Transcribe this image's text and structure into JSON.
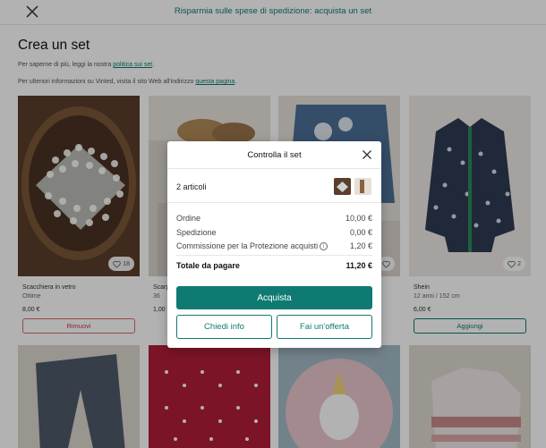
{
  "topbar": {
    "title": "Risparmia sulle spese di spedizione: acquista un set"
  },
  "page": {
    "heading": "Crea un set",
    "info1_text": "Per saperne di più, leggi la nostra ",
    "info1_link": "politica sui set",
    "info1_end": ".",
    "info2_text": "Per ulteriori informazioni su Vinted, visita il sito Web all'indirizzo ",
    "info2_link": "questa pagina",
    "info2_end": "."
  },
  "cards": [
    {
      "title": "Scacchiera in vetro",
      "subtitle": "Ottime",
      "price": "8,00 €",
      "favorites": "18",
      "button": "Rimuovi"
    },
    {
      "title": "Scarp",
      "subtitle": "36",
      "price": "1,00",
      "favorites": "",
      "button": ""
    },
    {
      "title": "",
      "subtitle": "",
      "price": "",
      "favorites": "",
      "button": ""
    },
    {
      "title": "Shein",
      "subtitle": "12 anni / 152 cm",
      "price": "6,00 €",
      "favorites": "2",
      "button": "Aggiungi"
    }
  ],
  "modal": {
    "title": "Controlla il set",
    "items_count": "2 articoli",
    "lines": [
      {
        "label": "Ordine",
        "value": "10,00 €"
      },
      {
        "label": "Spedizione",
        "value": "0,00 €"
      },
      {
        "label": "Commissione per la Protezione acquisti",
        "value": "1,20 €"
      }
    ],
    "total_label": "Totale da pagare",
    "total_value": "11,20 €",
    "buy_button": "Acquista",
    "ask_button": "Chiedi info",
    "offer_button": "Fai un'offerta"
  },
  "colors": {
    "accent": "#0f7a71",
    "remove": "#c23b3b"
  }
}
